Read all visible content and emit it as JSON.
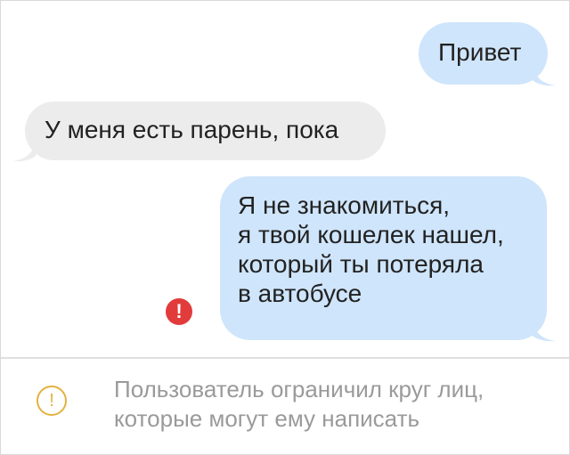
{
  "messages": [
    {
      "direction": "outgoing",
      "lines": [
        "Привет"
      ]
    },
    {
      "direction": "incoming",
      "lines": [
        "У меня есть парень, пока"
      ]
    },
    {
      "direction": "outgoing",
      "lines": [
        "Я не знакомиться,",
        "я твой кошелек нашел,",
        "который ты потеряла",
        "в автобусе"
      ],
      "status": "error"
    }
  ],
  "notice": {
    "lines": [
      "Пользователь ограничил круг лиц,",
      "которые могут ему написать"
    ]
  },
  "icons": {
    "error": "exclamation-error-icon",
    "warning": "warning-icon",
    "error_glyph": "!",
    "warning_glyph": "!"
  },
  "colors": {
    "outgoing_bubble": "#cfe5fb",
    "incoming_bubble": "#ececec",
    "error": "#e23b3b",
    "warning": "#e3b23f",
    "notice_text": "#9a9a9a"
  }
}
